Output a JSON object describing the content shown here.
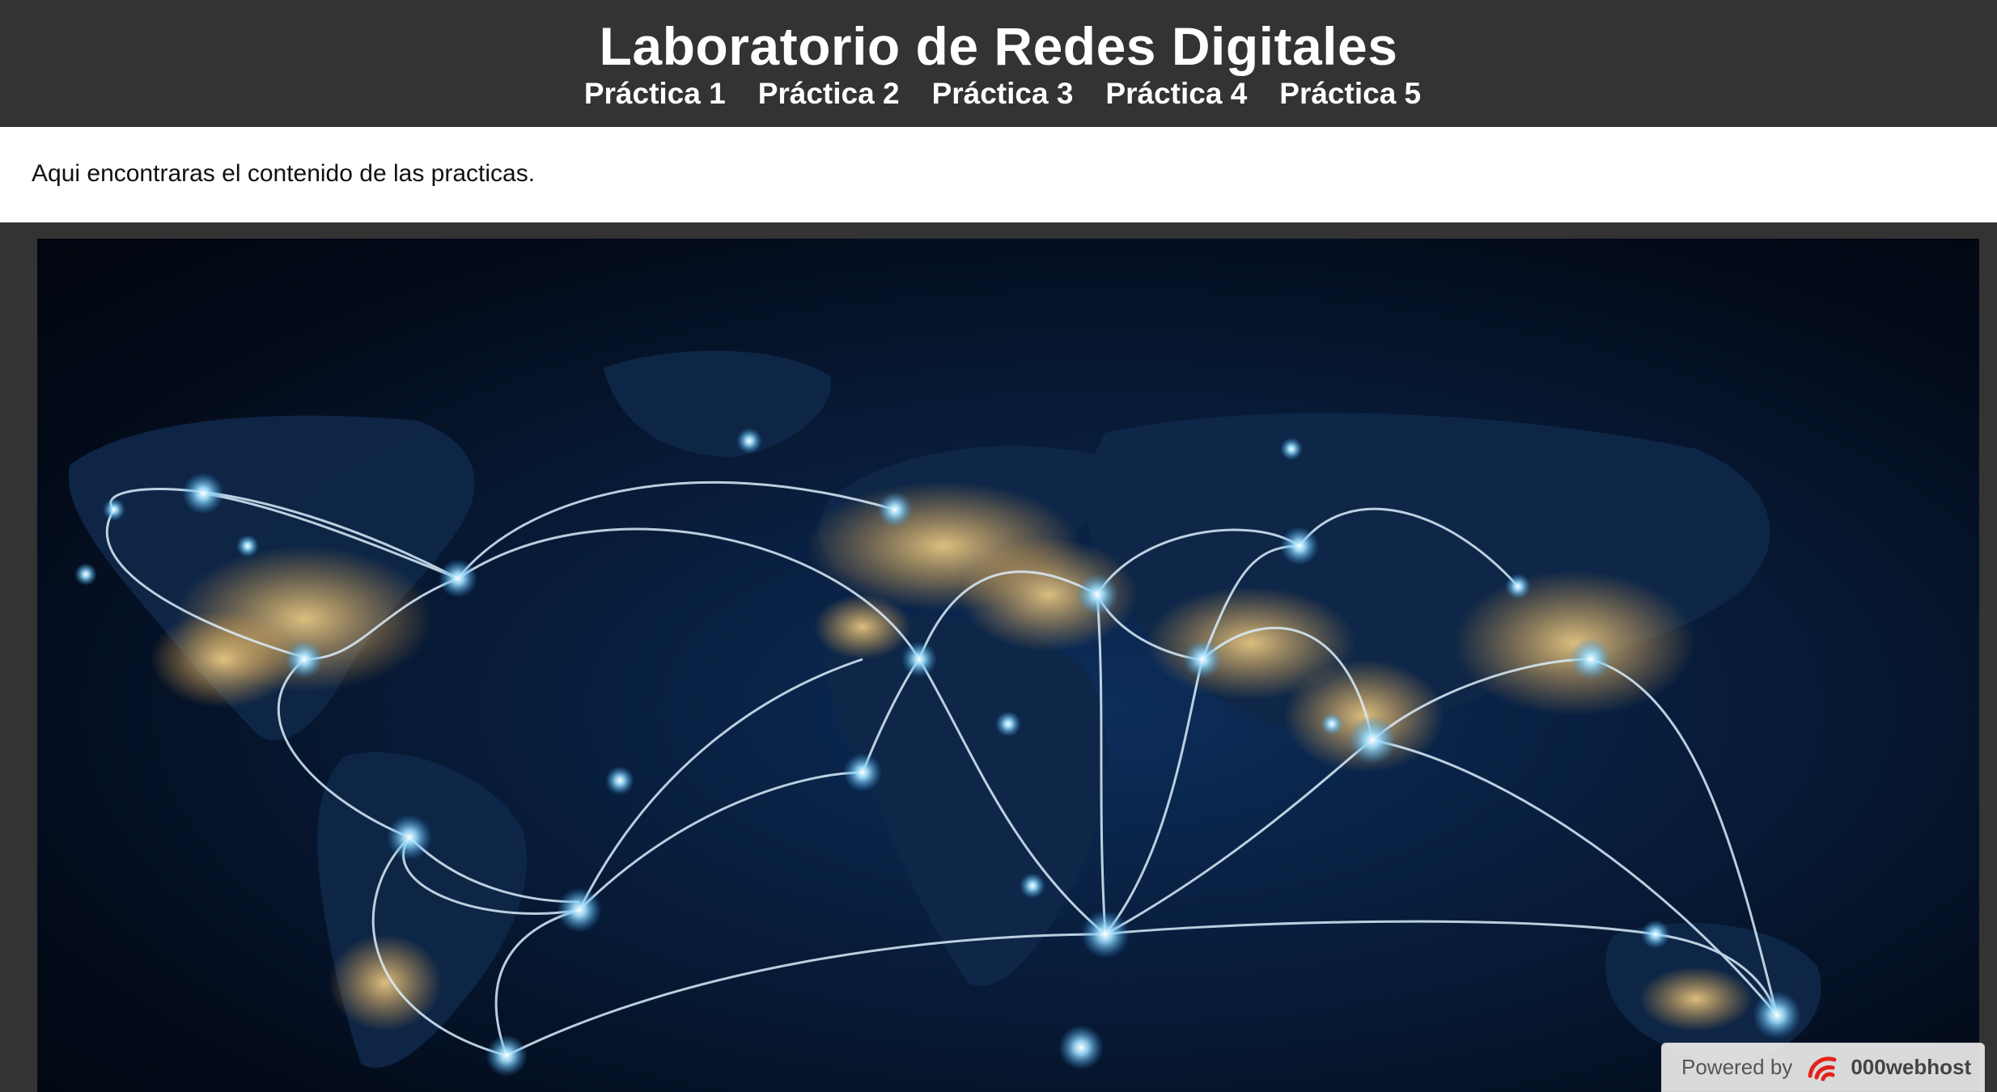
{
  "header": {
    "title": "Laboratorio de Redes Digitales",
    "nav": [
      {
        "label": "Práctica 1"
      },
      {
        "label": "Práctica 2"
      },
      {
        "label": "Práctica 3"
      },
      {
        "label": "Práctica 4"
      },
      {
        "label": "Práctica 5"
      }
    ]
  },
  "intro": {
    "text": "Aqui encontraras el contenido de las practicas."
  },
  "hero": {
    "image": "world-network-map-image"
  },
  "badge": {
    "prefix": "Powered by",
    "brand": "000webhost",
    "icon": "000webhost-logo-icon"
  },
  "colors": {
    "header_bg": "#333333",
    "intro_bg": "#ffffff",
    "glow": "#7fd4ff"
  }
}
